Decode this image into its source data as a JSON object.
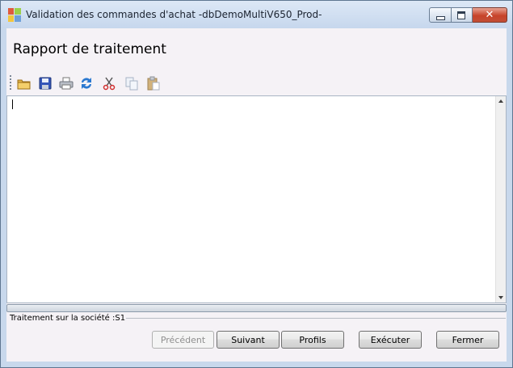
{
  "window": {
    "title": "Validation des commandes d'achat -dbDemoMultiV650_Prod-",
    "controls": {
      "minimize": "minimize-icon",
      "maximize": "maximize-icon",
      "close_glyph": "✕"
    }
  },
  "header": {
    "title": "Rapport de traitement"
  },
  "toolbar": {
    "items": [
      {
        "name": "open-folder-icon",
        "enabled": true
      },
      {
        "name": "save-icon",
        "enabled": true
      },
      {
        "name": "print-icon",
        "enabled": true
      },
      {
        "name": "refresh-icon",
        "enabled": true
      },
      {
        "name": "cut-icon",
        "enabled": true
      },
      {
        "name": "copy-icon",
        "enabled": false
      },
      {
        "name": "paste-icon",
        "enabled": false
      }
    ]
  },
  "report": {
    "text": ""
  },
  "progress": {
    "value": 0
  },
  "status": {
    "text": "Traitement sur la société :S1"
  },
  "buttons": {
    "previous": "Précédent",
    "next": "Suivant",
    "profiles": "Profils",
    "execute": "Exécuter",
    "close": "Fermer"
  }
}
